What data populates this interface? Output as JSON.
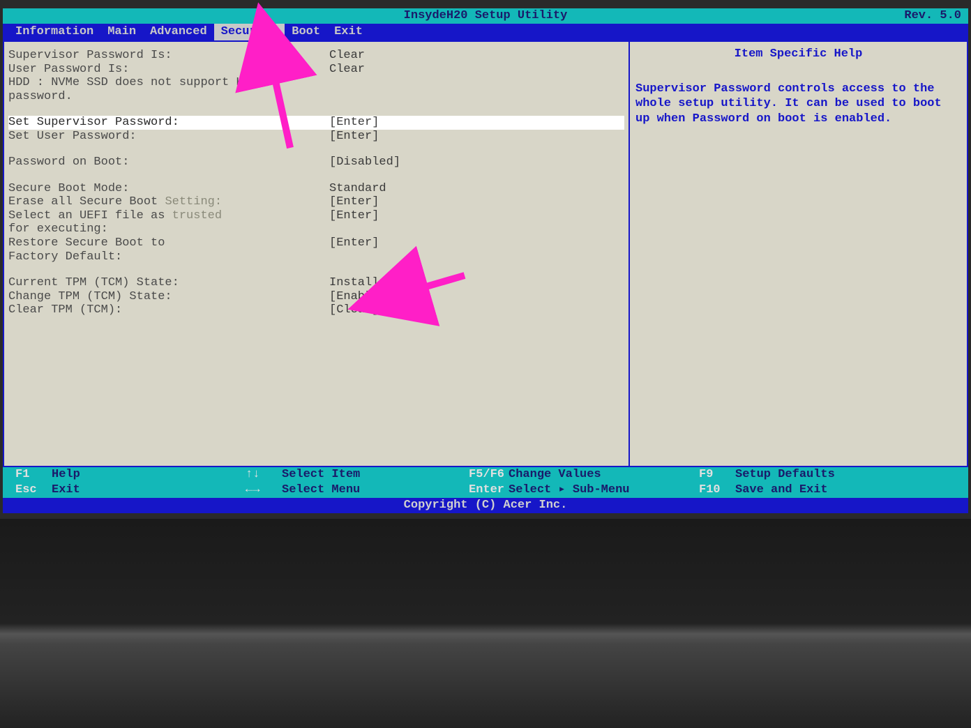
{
  "title": "InsydeH20 Setup Utility",
  "revision": "Rev. 5.0",
  "menu": {
    "items": [
      "Information",
      "Main",
      "Advanced",
      "Security",
      "Boot",
      "Exit"
    ],
    "active_index": 3
  },
  "security": {
    "supervisor_pw_label": "Supervisor Password Is:",
    "supervisor_pw_value": "Clear",
    "user_pw_label": "User Password Is:",
    "user_pw_value": "Clear",
    "hdd_note_line1": "HDD : NVMe SSD does not support HDD",
    "hdd_note_line2": "password.",
    "set_supervisor_label": "Set Supervisor Password:",
    "set_supervisor_value": "[Enter]",
    "set_user_label": "Set User Password:",
    "set_user_value": "[Enter]",
    "pw_on_boot_label": "Password on Boot:",
    "pw_on_boot_value": "[Disabled]",
    "secure_boot_mode_label": "Secure Boot Mode:",
    "secure_boot_mode_value": "Standard",
    "erase_sb_label": "Erase all Secure Boot ",
    "erase_sb_gray": "Setting:",
    "erase_sb_value": "[Enter]",
    "uefi_trusted_label1": "Select an UEFI file as ",
    "uefi_trusted_gray": "trusted",
    "uefi_trusted_label2": "for executing:",
    "uefi_trusted_value": "[Enter]",
    "restore_sb_label1": "Restore Secure Boot to",
    "restore_sb_label2": "Factory Default:",
    "restore_sb_value": "[Enter]",
    "tpm_state_label": "Current TPM (TCM) State:",
    "tpm_state_value": "Installed",
    "change_tpm_label": "Change TPM (TCM) State:",
    "change_tpm_value": "[Enabled]",
    "clear_tpm_label": "Clear TPM (TCM):",
    "clear_tpm_value": "[Clear]"
  },
  "help": {
    "title": "Item Specific Help",
    "body": "Supervisor Password controls access to the whole setup utility. It can be used to boot up when Password on boot is enabled."
  },
  "footer": {
    "f1": "F1",
    "f1_label": "Help",
    "esc": "Esc",
    "esc_label": "Exit",
    "updown": "↑↓",
    "updown_label": "Select Item",
    "leftright": "←→",
    "leftright_label": "Select Menu",
    "f5f6": "F5/F6",
    "f5f6_label": "Change Values",
    "enter": "Enter",
    "enter_label": "Select ▸ Sub-Menu",
    "f9": "F9",
    "f9_label": "Setup Defaults",
    "f10": "F10",
    "f10_label": "Save and Exit"
  },
  "copyright": "Copyright (C) Acer Inc."
}
